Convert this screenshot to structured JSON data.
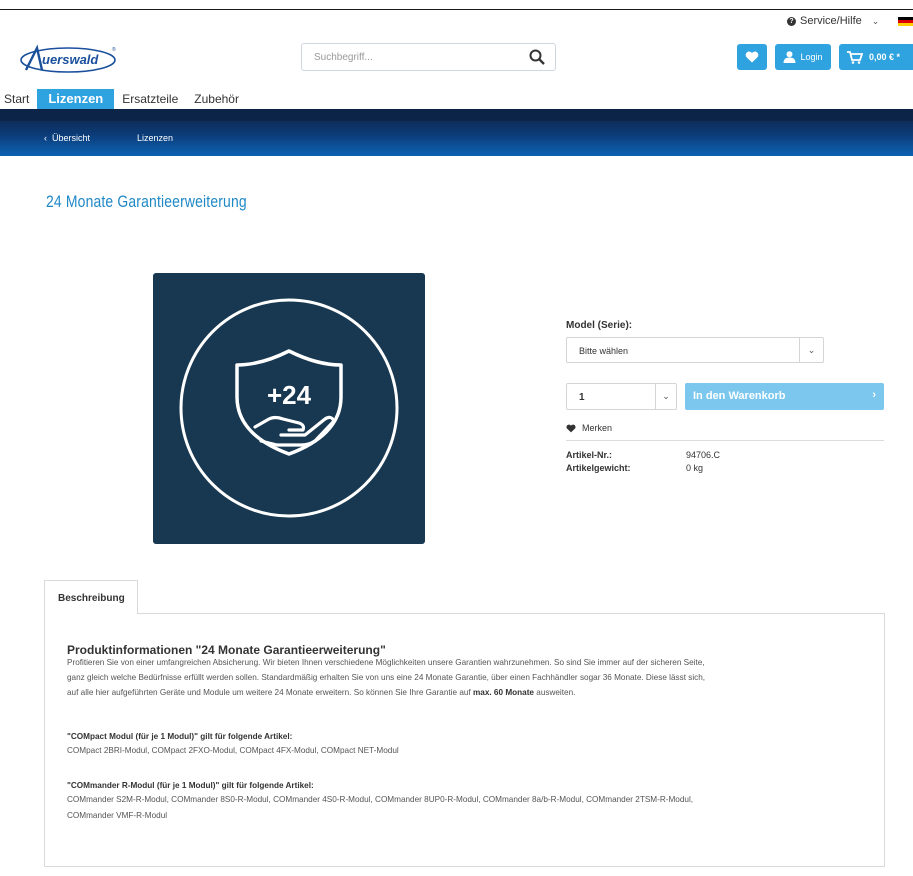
{
  "header": {
    "service_label": "Service/Hilfe",
    "search_placeholder": "Suchbegriff...",
    "login_label": "Login",
    "cart_total": "0,00 € *",
    "logo_text": "Auerswald"
  },
  "nav": {
    "items": [
      "Start",
      "Lizenzen",
      "Ersatzteile",
      "Zubehör"
    ],
    "active": "Lizenzen"
  },
  "breadcrumb": {
    "back": "Übersicht",
    "current": "Lizenzen"
  },
  "product": {
    "title": "24 Monate Garantieerweiterung",
    "image_text": "+24",
    "model_label": "Model (Serie):",
    "model_value": "Bitte wählen",
    "quantity": "1",
    "add_to_cart": "In den Warenkorb",
    "wishlist": "Merken",
    "article_no_label": "Artikel-Nr.:",
    "article_no": "94706.C",
    "weight_label": "Artikelgewicht:",
    "weight": "0 kg"
  },
  "tabs": {
    "description": "Beschreibung"
  },
  "description": {
    "heading": "Produktinformationen \"24 Monate Garantieerweiterung\"",
    "line1": "Profitieren Sie von einer umfangreichen Absicherung. Wir bieten Ihnen verschiedene Möglichkeiten unsere Garantien wahrzunehmen. So sind Sie immer auf der sicheren Seite,",
    "line2": "ganz gleich welche Bedürfnisse erfüllt werden sollen. Standardmäßig erhalten Sie von uns eine 24 Monate Garantie, über einen Fachhändler sogar 36 Monate. Diese lässt sich,",
    "line3_a": "auf alle hier aufgeführten Geräte und Module um weitere 24 Monate erweitern. So können Sie Ihre Garantie auf",
    "line3_bold": "max. 60 Monate",
    "line3_b": "ausweiten.",
    "compact_heading": "\"COMpact Modul (für je 1 Modul)\" gilt für folgende Artikel:",
    "compact_items": "COMpact 2BRI-Modul, COMpact 2FXO-Modul, COMpact 4FX-Modul, COMpact NET-Modul",
    "commander_heading": "\"COMmander R-Modul (für je 1 Modul)\" gilt für folgende Artikel:",
    "commander_items_1": "COMmander S2M-R-Modul, COMmander 8S0-R-Modul, COMmander 4S0-R-Modul, COMmander 8UP0-R-Modul, COMmander 8a/b-R-Modul, COMmander 2TSM-R-Modul,",
    "commander_items_2": "COMmander VMF-R-Modul"
  },
  "colors": {
    "accent": "#2fa2e0",
    "title_blue": "#1f88c6",
    "image_bg": "#173850",
    "band_dark": "#0b2448"
  }
}
